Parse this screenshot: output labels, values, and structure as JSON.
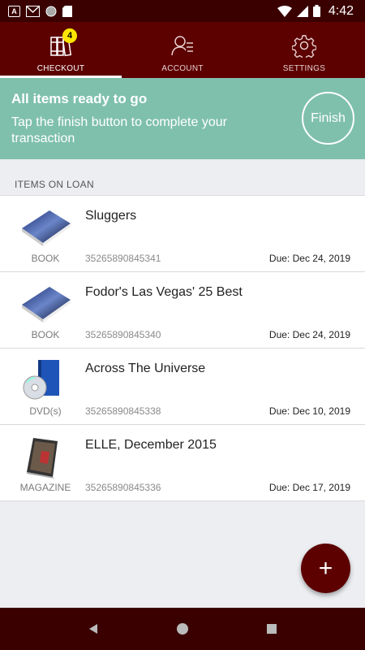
{
  "status_bar": {
    "time": "4:42",
    "icons": [
      "a-icon",
      "gmail-icon",
      "circle-icon",
      "sd-card-icon",
      "wifi-icon",
      "signal-icon",
      "battery-icon"
    ]
  },
  "tabs": [
    {
      "label": "CHECKOUT",
      "icon": "books-icon",
      "badge": "4",
      "active": true
    },
    {
      "label": "ACCOUNT",
      "icon": "account-icon",
      "active": false
    },
    {
      "label": "SETTINGS",
      "icon": "gear-icon",
      "active": false
    }
  ],
  "banner": {
    "title": "All items ready to go",
    "message": "Tap the finish button to complete your transaction",
    "finish_label": "Finish"
  },
  "section_header": "ITEMS ON LOAN",
  "items": [
    {
      "title": "Sluggers",
      "type": "BOOK",
      "barcode": "35265890845341",
      "due": "Due: Dec 24, 2019",
      "icon": "book-icon"
    },
    {
      "title": "Fodor's Las Vegas' 25 Best",
      "type": "BOOK",
      "barcode": "35265890845340",
      "due": "Due: Dec 24, 2019",
      "icon": "book-icon"
    },
    {
      "title": "Across The Universe",
      "type": "DVD(s)",
      "barcode": "35265890845338",
      "due": "Due: Dec 10, 2019",
      "icon": "dvd-icon"
    },
    {
      "title": "ELLE, December 2015",
      "type": "MAGAZINE",
      "barcode": "35265890845336",
      "due": "Due: Dec 17, 2019",
      "icon": "magazine-icon"
    }
  ],
  "fab": {
    "label": "+"
  },
  "colors": {
    "primary": "#5c0000",
    "status": "#3a0000",
    "banner": "#7fc0ad",
    "badge": "#ffe600"
  }
}
